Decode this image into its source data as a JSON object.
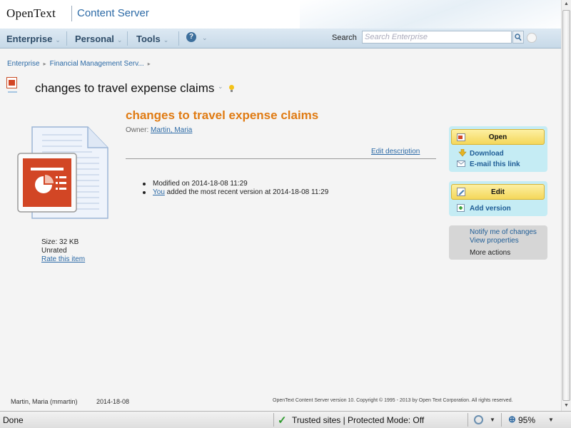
{
  "branding": {
    "vendor": "OpenText",
    "product": "Content Server"
  },
  "nav": {
    "items": [
      {
        "label": "Enterprise"
      },
      {
        "label": "Personal"
      },
      {
        "label": "Tools"
      }
    ],
    "search_label": "Search",
    "search_placeholder": "Search Enterprise"
  },
  "breadcrumb": [
    "Enterprise",
    "Financial Management Serv..."
  ],
  "page_title": "changes to travel expense claims",
  "document": {
    "name": "changes to travel expense claims",
    "owner_label": "Owner:",
    "owner": "Martin, Maria",
    "edit_description": "Edit description",
    "size_label": "Size:",
    "size_value": "32 KB",
    "rating": "Unrated",
    "rate_link": "Rate this item",
    "modified": "Modified on 2014-18-08 11:29",
    "version_user": "You",
    "version_text": "added the most recent version at 2014-18-08 11:29"
  },
  "actions": {
    "open": "Open",
    "download": "Download",
    "email_link": "E-mail this link",
    "edit": "Edit",
    "add_version": "Add version",
    "notify": "Notify me of changes",
    "view_properties": "View properties",
    "more_actions": "More actions"
  },
  "footer": {
    "user": "Martin, Maria (mmartin)",
    "date": "2014-18-08",
    "copyright": "OpenText Content Server version 10. Copyright © 1995 - 2013 by Open Text Corporation. All rights reserved."
  },
  "statusbar": {
    "status": "Done",
    "zone": "Trusted sites | Protected Mode: Off",
    "zoom": "95%"
  },
  "colors": {
    "accent": "#e07b13",
    "link": "#2c6aa6",
    "action_panel": "#c5ecf4",
    "button": "#f4d75a"
  }
}
